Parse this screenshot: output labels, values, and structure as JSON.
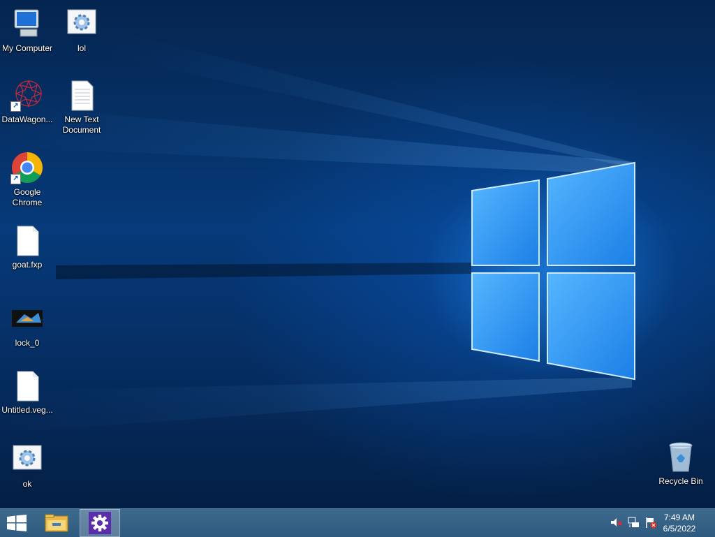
{
  "desktop": {
    "icons": [
      {
        "label": "My Computer",
        "icon": "computer-icon"
      },
      {
        "label": "lol",
        "icon": "settings-file-icon"
      },
      {
        "label": "DataWagon...",
        "icon": "datawagon-icon"
      },
      {
        "label": "New Text Document",
        "icon": "text-document-icon"
      },
      {
        "label": "Google Chrome",
        "icon": "chrome-icon"
      },
      {
        "label": "goat.fxp",
        "icon": "blank-file-icon"
      },
      {
        "label": "lock_0",
        "icon": "lock-image-icon"
      },
      {
        "label": "Untitled.veg...",
        "icon": "blank-file-icon"
      },
      {
        "label": "ok",
        "icon": "settings-file-icon"
      },
      {
        "label": "Recycle Bin",
        "icon": "recycle-bin-icon"
      }
    ]
  },
  "taskbar": {
    "start_icon": "windows-logo-icon",
    "pinned": [
      {
        "name": "file-explorer",
        "icon": "folder-icon"
      },
      {
        "name": "settings",
        "icon": "gear-icon",
        "active": true
      }
    ],
    "tray": {
      "icons": [
        "volume-muted-icon",
        "network-icon",
        "action-center-flag-icon"
      ],
      "time": "7:49 AM",
      "date": "6/5/2022"
    }
  },
  "colors": {
    "taskbar": "#2f5a7f",
    "accent": "#1e90ff",
    "settings_tile": "#5b2dad"
  }
}
